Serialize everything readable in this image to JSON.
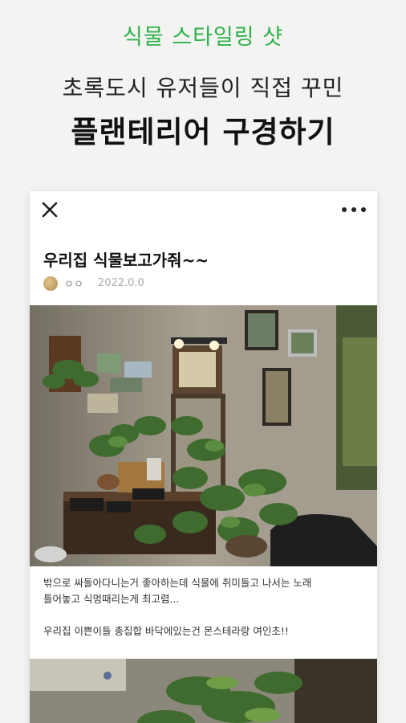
{
  "promo": {
    "eyebrow": "식물 스타일링 샷",
    "line1": "초록도시 유저들이 직접 꾸민",
    "line2": "플랜테리어 구경하기"
  },
  "post": {
    "title": "우리집 식물보고가줘~~",
    "author": "ㅇㅇ",
    "date": "2022.0.0",
    "caption_line1": "밖으로 싸돌아다니는거 좋아하는데 식물에 취미들고 나서는 노래",
    "caption_line2": "틀어놓고 식멍때리는게 최고렴...",
    "caption_line3": "우리집 이쁜이들 총집합 바닥에있는건 몬스테라랑 여인초!!"
  },
  "icons": {
    "close": "close-icon",
    "more": "more-icon"
  },
  "colors": {
    "accent": "#2fb24a",
    "background": "#f3f3f1"
  }
}
